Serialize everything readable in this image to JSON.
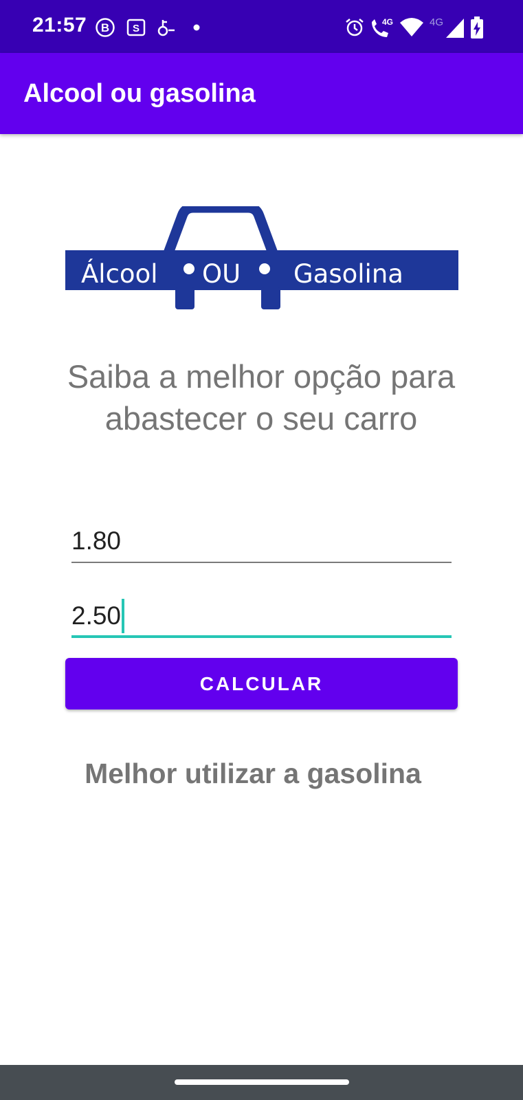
{
  "status_bar": {
    "time": "21:57",
    "network_label_1": "4G",
    "network_label_2": "4G",
    "notification_icons": [
      "b-badge-icon",
      "s-badge-icon",
      "key-icon",
      "dot-icon"
    ],
    "system_icons": [
      "alarm-icon",
      "volte-call-icon",
      "wifi-icon",
      "signal-icon",
      "battery-charging-icon"
    ]
  },
  "app_bar": {
    "title": "Alcool ou gasolina"
  },
  "logo": {
    "text_left": "Álcool",
    "text_middle": "OU",
    "text_right": "Gasolina",
    "color": "#1e3799"
  },
  "main": {
    "tagline": "Saiba a melhor opção para abastecer o seu carro",
    "alcohol_price_value": "1.80",
    "gasoline_price_value": "2.50",
    "calculate_button_label": "CALCULAR",
    "result_text": "Melhor utilizar a gasolina"
  },
  "colors": {
    "status_bar": "#3700b3",
    "primary": "#6200ee",
    "accent": "#26c6b5"
  }
}
